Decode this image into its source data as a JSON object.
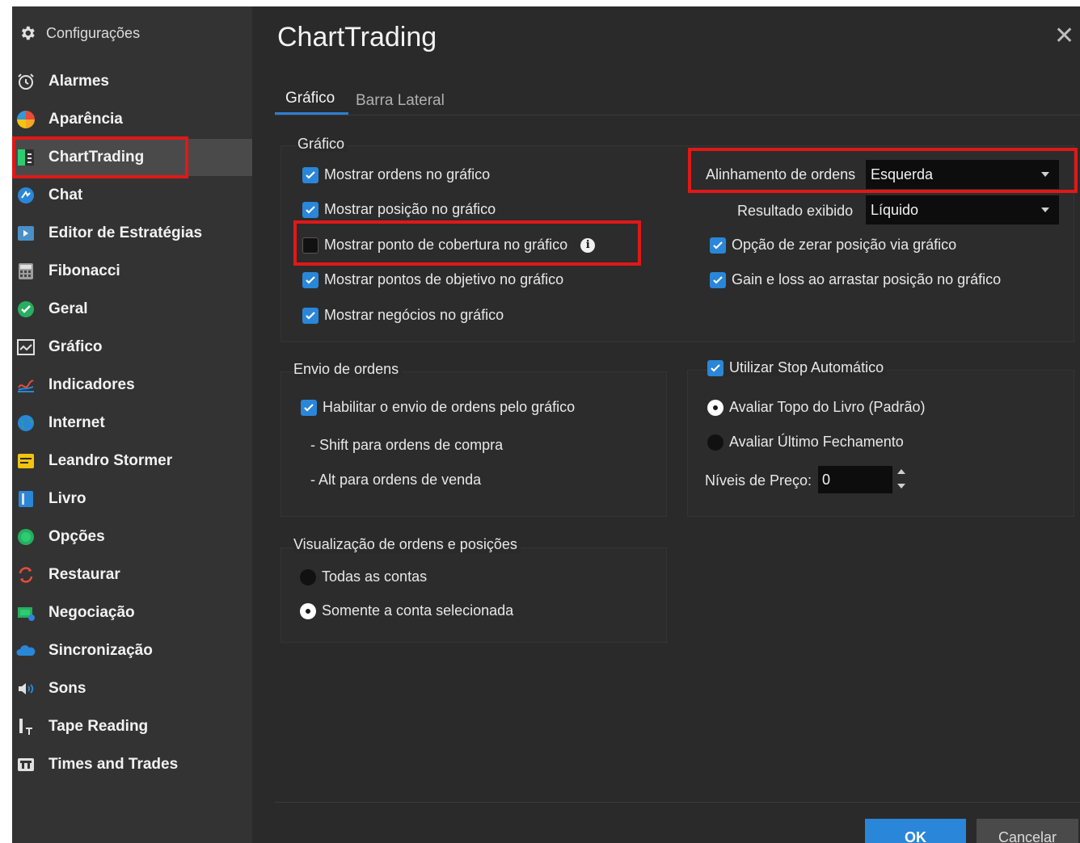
{
  "sidebar": {
    "header_label": "Configurações",
    "items": [
      {
        "label": "Alarmes",
        "icon": "alarm-icon"
      },
      {
        "label": "Aparência",
        "icon": "appearance-icon"
      },
      {
        "label": "ChartTrading",
        "icon": "charttrading-icon"
      },
      {
        "label": "Chat",
        "icon": "chat-icon"
      },
      {
        "label": "Editor de Estratégias",
        "icon": "strategy-editor-icon"
      },
      {
        "label": "Fibonacci",
        "icon": "fibonacci-icon"
      },
      {
        "label": "Geral",
        "icon": "general-icon"
      },
      {
        "label": "Gráfico",
        "icon": "chart-icon"
      },
      {
        "label": "Indicadores",
        "icon": "indicators-icon"
      },
      {
        "label": "Internet",
        "icon": "internet-icon"
      },
      {
        "label": "Leandro Stormer",
        "icon": "user-plugin-icon"
      },
      {
        "label": "Livro",
        "icon": "book-icon"
      },
      {
        "label": "Opções",
        "icon": "options-icon"
      },
      {
        "label": "Restaurar",
        "icon": "restore-icon"
      },
      {
        "label": "Negociação",
        "icon": "trading-icon"
      },
      {
        "label": "Sincronização",
        "icon": "sync-icon"
      },
      {
        "label": "Sons",
        "icon": "sound-icon"
      },
      {
        "label": "Tape Reading",
        "icon": "tape-reading-icon"
      },
      {
        "label": "Times and Trades",
        "icon": "times-trades-icon"
      }
    ],
    "active_index": 2
  },
  "main": {
    "title": "ChartTrading",
    "tabs": [
      {
        "label": "Gráfico",
        "active": true
      },
      {
        "label": "Barra Lateral",
        "active": false
      }
    ],
    "grafico_group": {
      "legend": "Gráfico",
      "checks": [
        {
          "label": "Mostrar ordens no gráfico",
          "checked": true
        },
        {
          "label": "Mostrar posição no gráfico",
          "checked": true
        },
        {
          "label": "Mostrar ponto de cobertura no gráfico",
          "checked": false
        },
        {
          "label": "Mostrar pontos de objetivo no gráfico",
          "checked": true
        },
        {
          "label": "Mostrar negócios no gráfico",
          "checked": true
        }
      ],
      "alinhamento_label": "Alinhamento de ordens",
      "alinhamento_value": "Esquerda",
      "resultado_label": "Resultado exibido",
      "resultado_value": "Líquido",
      "right_checks": [
        {
          "label": "Opção de zerar posição via gráfico",
          "checked": true
        },
        {
          "label": "Gain e loss ao arrastar posição no gráfico",
          "checked": true
        }
      ]
    },
    "envio_group": {
      "legend": "Envio de ordens",
      "check_label": "Habilitar o envio de ordens pelo gráfico",
      "checked": true,
      "hint_buy": "- Shift para ordens de compra",
      "hint_sell": "- Alt para ordens de venda"
    },
    "stop_group": {
      "legend_check_label": "Utilizar Stop Automático",
      "checked": true,
      "radio_top": "Avaliar Topo do Livro (Padrão)",
      "radio_last": "Avaliar Último Fechamento",
      "selected": "top",
      "niveis_label": "Níveis de Preço:",
      "niveis_value": "0"
    },
    "visual_group": {
      "legend": "Visualização de ordens e posições",
      "radio_all": "Todas as contas",
      "radio_selected": "Somente a conta selecionada",
      "selected": "selected"
    }
  },
  "footer": {
    "ok_label": "OK",
    "cancel_label": "Cancelar"
  },
  "colors": {
    "accent": "#2a86d8",
    "highlight": "#e01818",
    "background": "#2a2a2a",
    "sidebar": "#333333"
  }
}
